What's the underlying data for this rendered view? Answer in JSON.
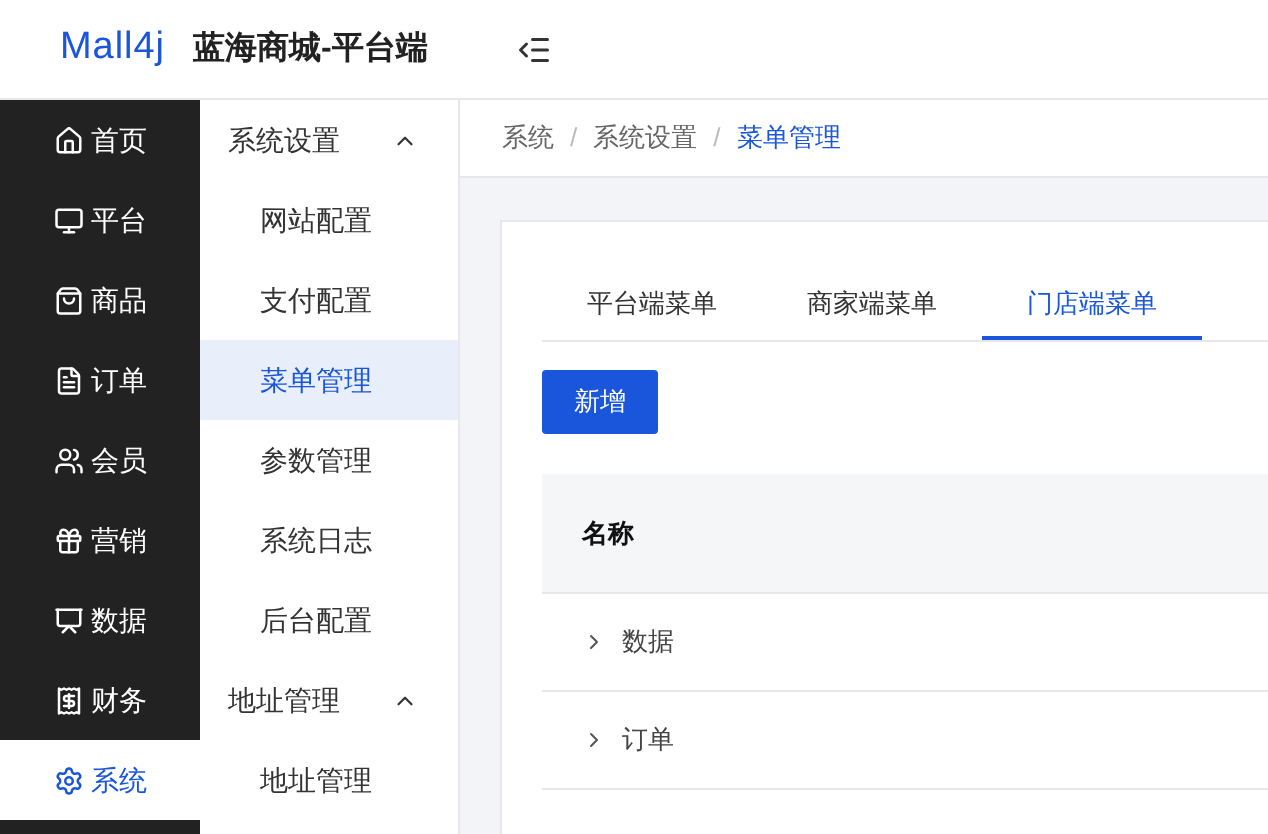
{
  "header": {
    "logo": "Mall4j",
    "title": "蓝海商城-平台端"
  },
  "main_nav": [
    {
      "label": "首页",
      "selected": false
    },
    {
      "label": "平台",
      "selected": false
    },
    {
      "label": "商品",
      "selected": false
    },
    {
      "label": "订单",
      "selected": false
    },
    {
      "label": "会员",
      "selected": false
    },
    {
      "label": "营销",
      "selected": false
    },
    {
      "label": "数据",
      "selected": false
    },
    {
      "label": "财务",
      "selected": false
    },
    {
      "label": "系统",
      "selected": true
    }
  ],
  "sub_nav": [
    {
      "label": "系统设置",
      "expanded": true,
      "children": [
        {
          "label": "网站配置",
          "selected": false
        },
        {
          "label": "支付配置",
          "selected": false
        },
        {
          "label": "菜单管理",
          "selected": true
        },
        {
          "label": "参数管理",
          "selected": false
        },
        {
          "label": "系统日志",
          "selected": false
        },
        {
          "label": "后台配置",
          "selected": false
        }
      ]
    },
    {
      "label": "地址管理",
      "expanded": true,
      "children": [
        {
          "label": "地址管理",
          "selected": false
        }
      ]
    }
  ],
  "breadcrumb": [
    {
      "label": "系统"
    },
    {
      "separator": "/"
    },
    {
      "label": "系统设置"
    },
    {
      "separator": "/"
    },
    {
      "label": "菜单管理"
    }
  ],
  "tabs": [
    {
      "label": "平台端菜单",
      "selected": false
    },
    {
      "label": "商家端菜单",
      "selected": false
    },
    {
      "label": "门店端菜单",
      "selected": true
    }
  ],
  "add_button": "新增",
  "table": {
    "columns": [
      "名称"
    ],
    "rows": [
      {
        "name": "数据"
      },
      {
        "name": "订单"
      }
    ]
  }
}
